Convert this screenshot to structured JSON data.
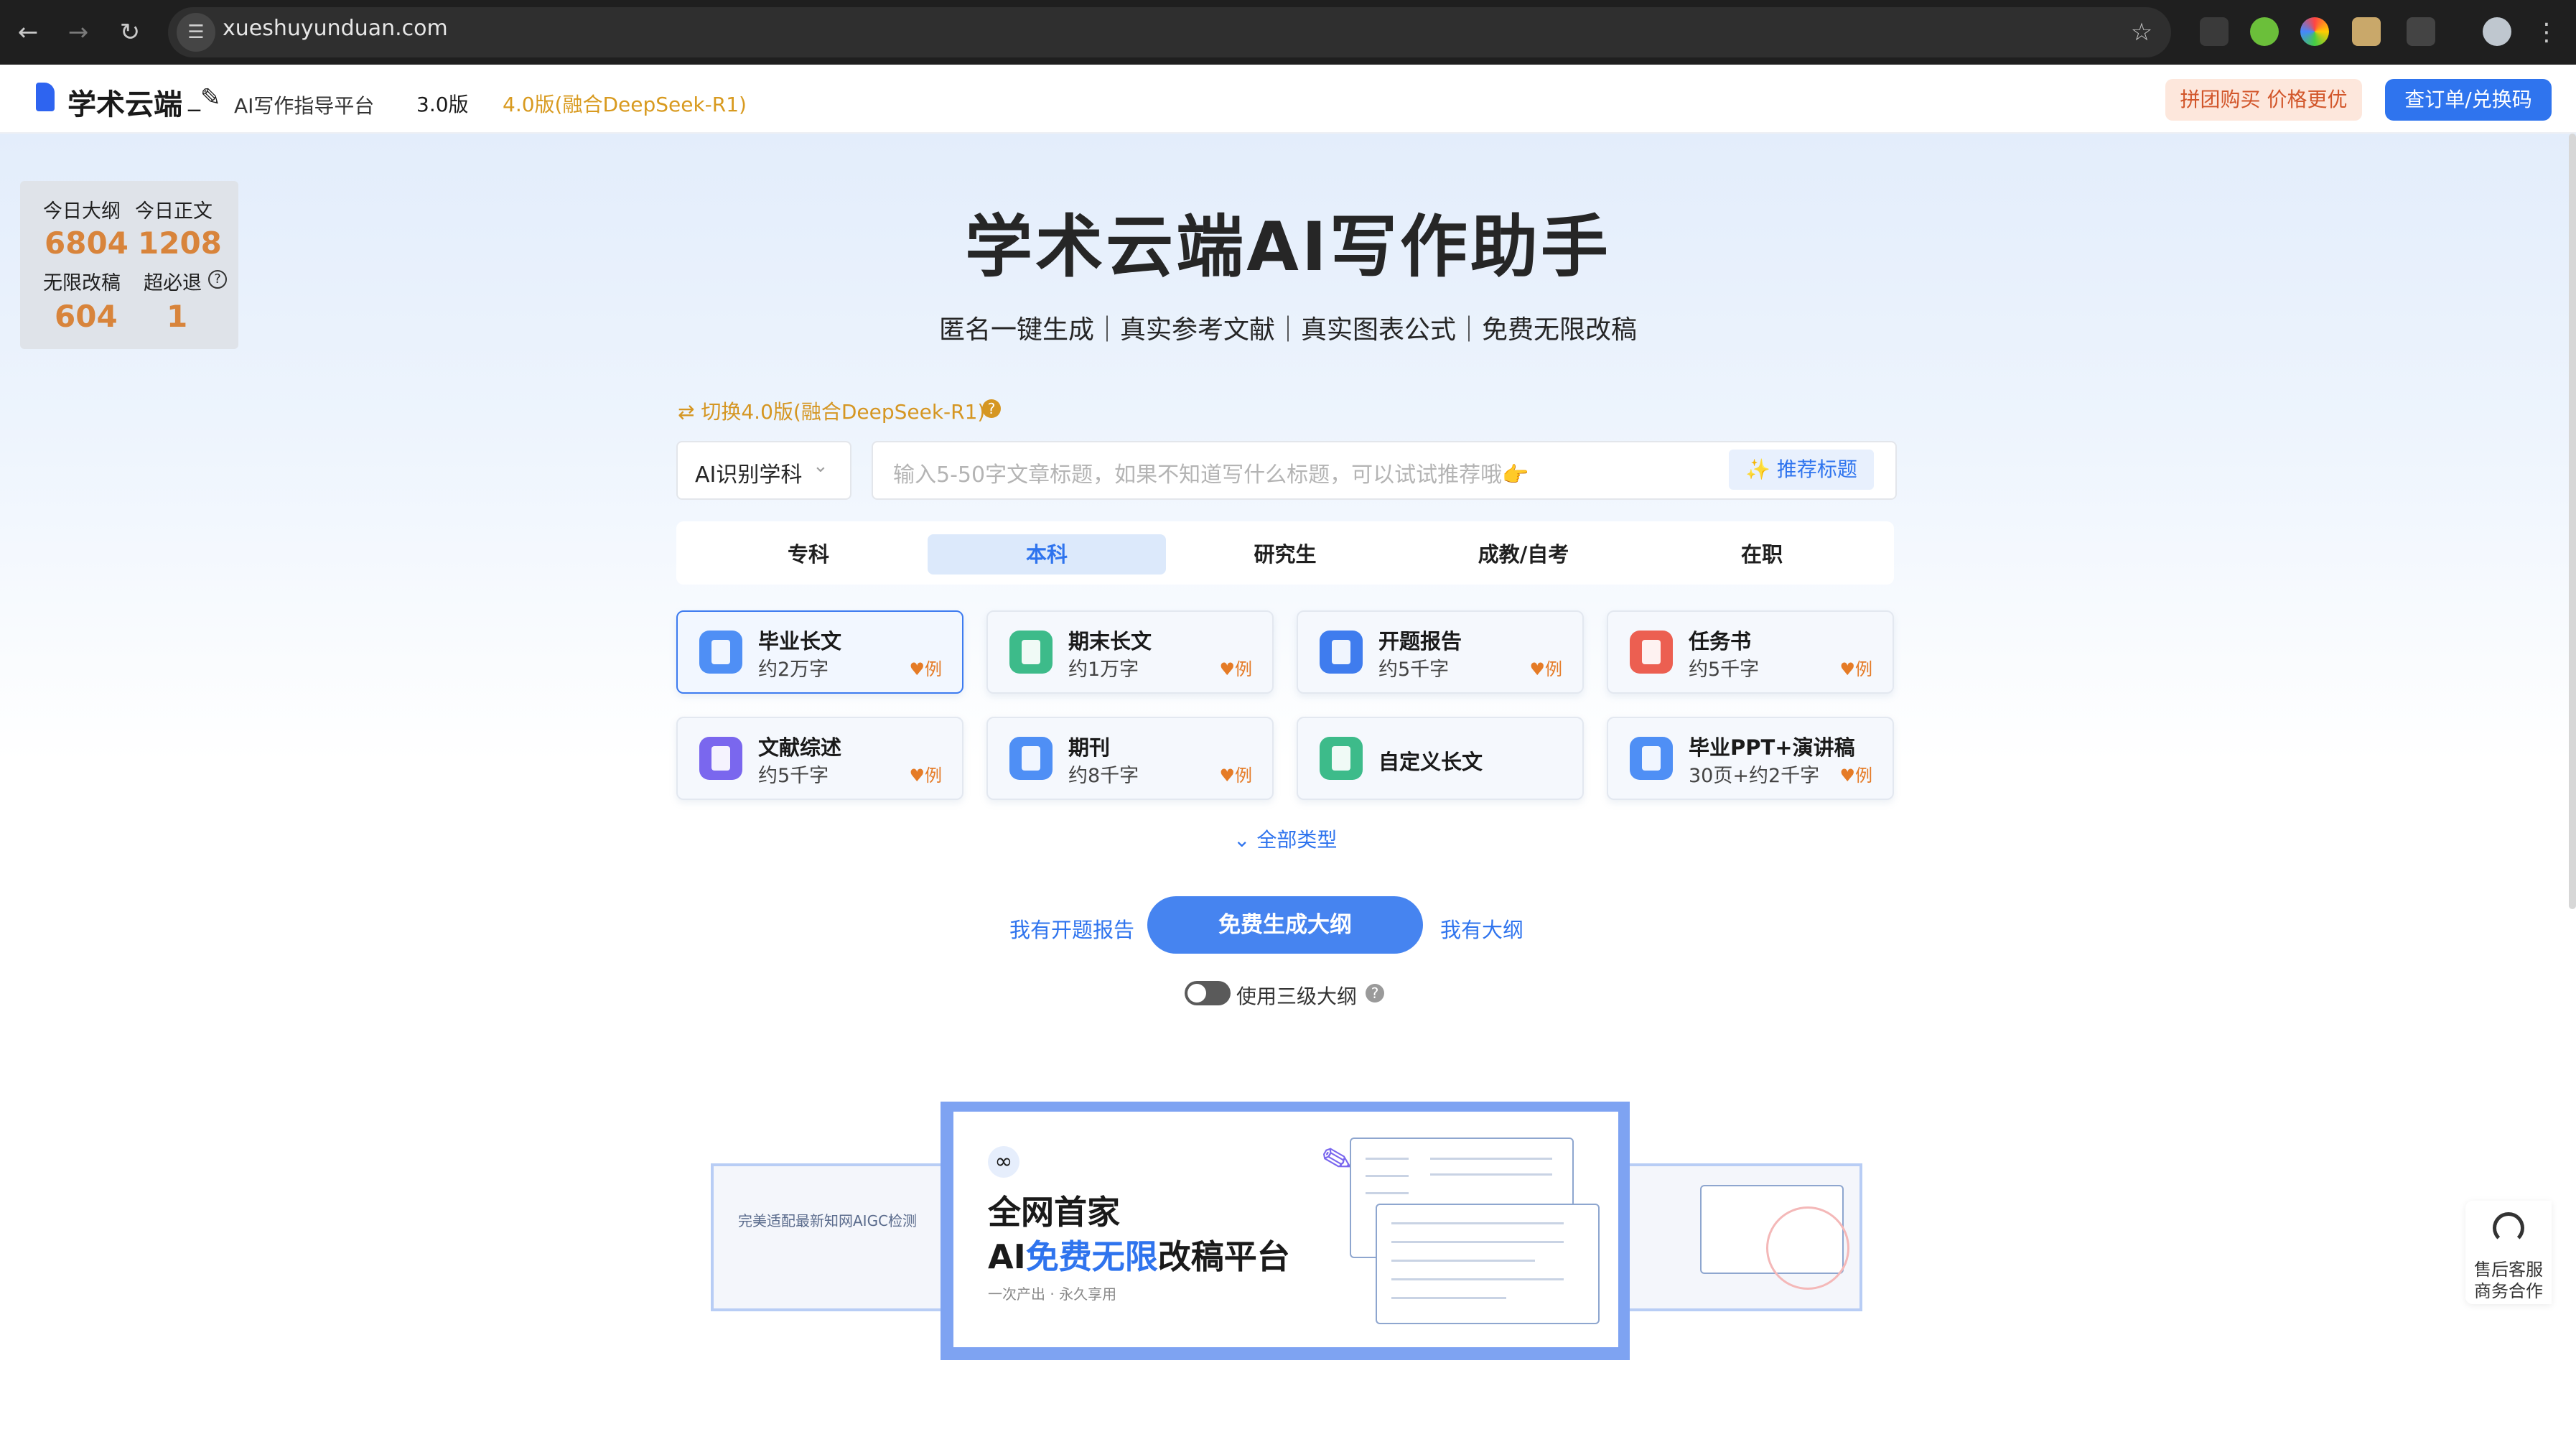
{
  "browser": {
    "url": "xueshuyunduan.com",
    "back_icon": "arrow-left",
    "forward_icon": "arrow-right",
    "reload_icon": "reload",
    "star_icon": "star"
  },
  "header": {
    "logo_text": "学术云端",
    "logo_subtitle": "AI写作指导平台",
    "nav": [
      "3.0版",
      "4.0版(融合DeepSeek-R1)"
    ],
    "group_buy": "拼团购买 价格更优",
    "order_button": "查订单/兑换码"
  },
  "stats": {
    "outline_label": "今日大纲",
    "outline_value": "6804",
    "text_label": "今日正文",
    "text_value": "1208",
    "revise_label": "无限改稿",
    "revise_value": "604",
    "refund_label": "超必退",
    "refund_value": "1"
  },
  "hero": {
    "title": "学术云端AI写作助手",
    "subtitle": "匿名一键生成｜真实参考文献｜真实图表公式｜免费无限改稿",
    "switch_link": "⇄ 切换4.0版(融合DeepSeek-R1)"
  },
  "search": {
    "subject_select": "AI识别学科",
    "placeholder": "输入5-50字文章标题，如果不知道写什么标题，可以试试推荐哦👉",
    "recommend_button": "推荐标题"
  },
  "tabs": [
    "专科",
    "本科",
    "研究生",
    "成教/自考",
    "在职"
  ],
  "active_tab": "本科",
  "cards": [
    {
      "title": "毕业长文",
      "sub": "约2万字",
      "example": "例",
      "color": "#4f8ff5"
    },
    {
      "title": "期末长文",
      "sub": "约1万字",
      "example": "例",
      "color": "#3dbb8a"
    },
    {
      "title": "开题报告",
      "sub": "约5千字",
      "example": "例",
      "color": "#3f7cee"
    },
    {
      "title": "任务书",
      "sub": "约5千字",
      "example": "例",
      "color": "#ec5f51"
    },
    {
      "title": "文献综述",
      "sub": "约5千字",
      "example": "例",
      "color": "#7a67ee"
    },
    {
      "title": "期刊",
      "sub": "约8千字",
      "example": "例",
      "color": "#4f8ff5"
    },
    {
      "title": "自定义长文",
      "sub": "",
      "example": "",
      "color": "#3dbb8a"
    },
    {
      "title": "毕业PPT+演讲稿",
      "sub": "30页+约2千字",
      "example": "例",
      "color": "#4f8ff5"
    }
  ],
  "all_types": "全部类型",
  "actions": {
    "have_proposal": "我有开题报告",
    "generate": "免费生成大纲",
    "have_outline": "我有大纲",
    "three_level": "使用三级大纲"
  },
  "banner": {
    "line1": "全网首家",
    "line2_prefix": "AI",
    "line2_highlight": "免费无限",
    "line2_suffix": "改稿平台",
    "small": "一次产出 · 永久享用",
    "left_text": "完美适配最新知网AIGC检测"
  },
  "service": {
    "line1": "售后客服",
    "line2": "商务合作"
  }
}
